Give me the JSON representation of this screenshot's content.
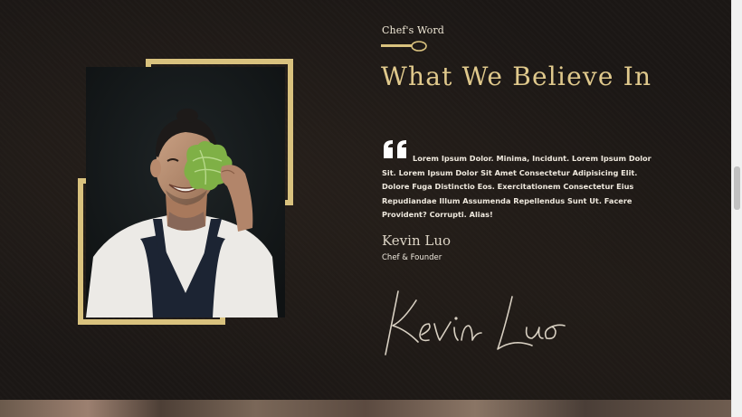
{
  "section": {
    "kicker": "Chef's Word",
    "heading": "What We Believe In"
  },
  "quote": {
    "text": "Lorem Ipsum Dolor. Minima, Incidunt. Lorem Ipsum Dolor Sit. Lorem Ipsum Dolor Sit Amet Consectetur Adipisicing Elit. Dolore Fuga Distinctio Eos. Exercitationem Consectetur Eius Repudiandae Illum Assumenda Repellendus Sunt Ut. Facere Provident? Corrupti. Alias!"
  },
  "author": {
    "name": "Kevin Luo",
    "role": "Chef & Founder",
    "signature": "Kevin Luo"
  },
  "colors": {
    "gold": "#d9c27e",
    "heading_gold": "#e0c98c",
    "background": "#1b1715"
  },
  "icons": {
    "divider": "spoon-icon",
    "quote": "quote-icon"
  }
}
